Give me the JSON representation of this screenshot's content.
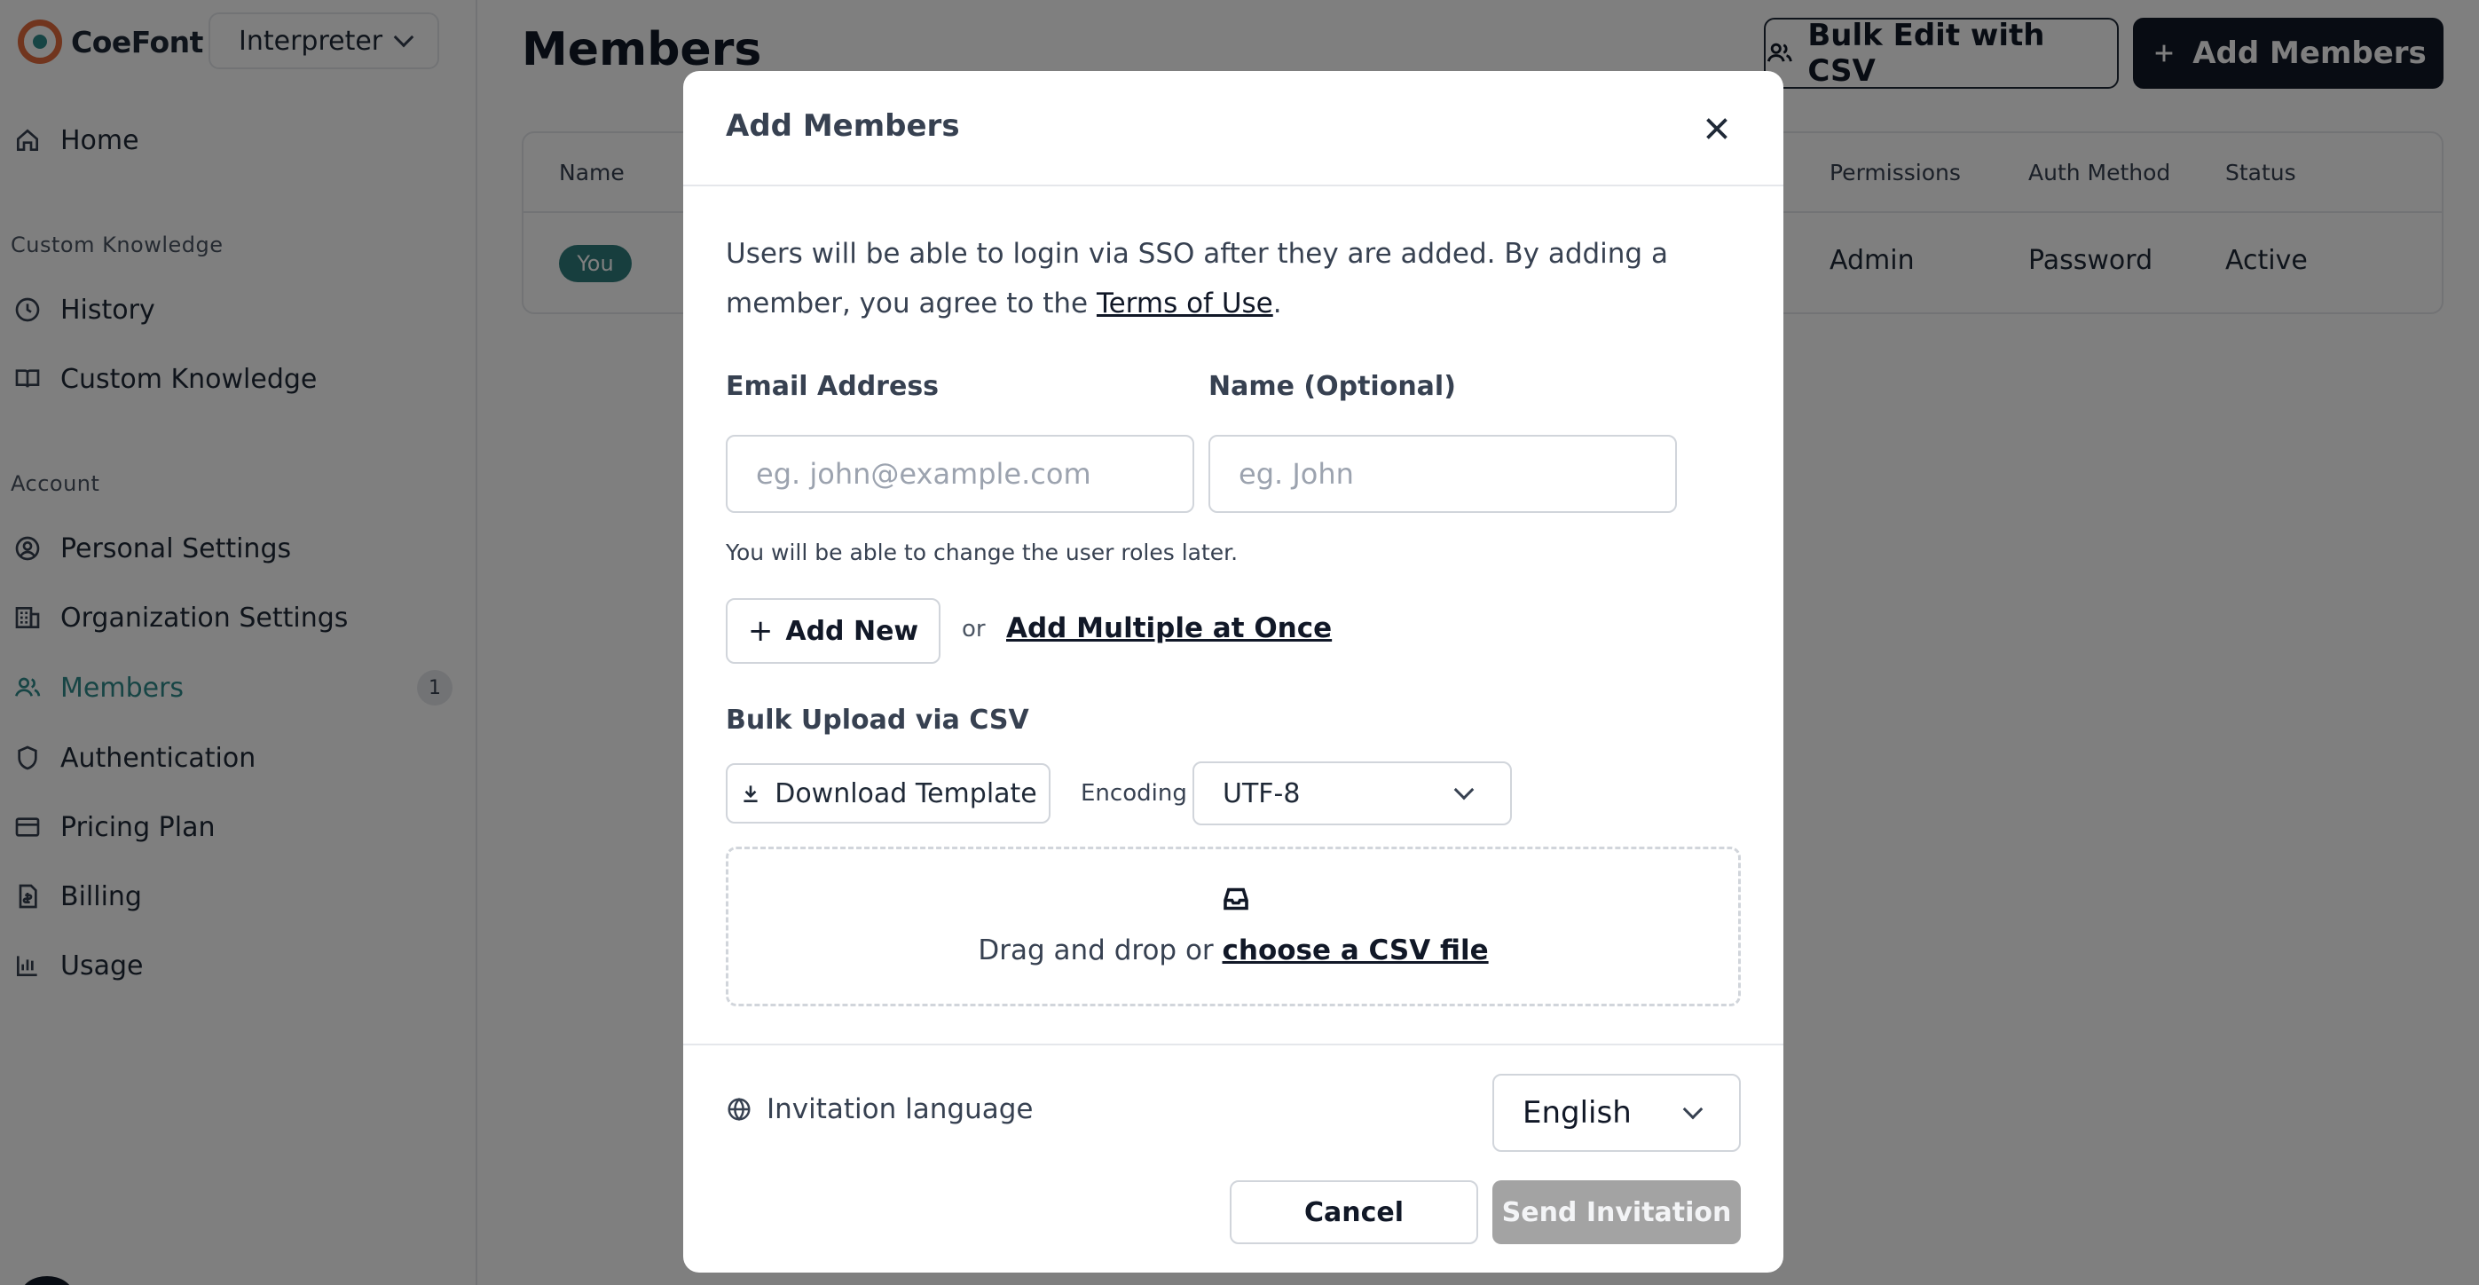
{
  "app": {
    "brand": "CoeFont",
    "workspace": "Interpreter"
  },
  "sidebar": {
    "items": [
      {
        "label": "Home",
        "icon": "home-icon"
      },
      {
        "section": "Custom Knowledge"
      },
      {
        "label": "History",
        "icon": "clock-icon"
      },
      {
        "label": "Custom Knowledge",
        "icon": "book-icon"
      },
      {
        "section": "Account"
      },
      {
        "label": "Personal Settings",
        "icon": "user-circle-icon"
      },
      {
        "label": "Organization Settings",
        "icon": "building-icon"
      },
      {
        "label": "Members",
        "icon": "users-icon",
        "active": true,
        "count": "1"
      },
      {
        "label": "Authentication",
        "icon": "shield-icon"
      },
      {
        "label": "Pricing Plan",
        "icon": "credit-card-icon"
      },
      {
        "label": "Billing",
        "icon": "receipt-icon"
      },
      {
        "label": "Usage",
        "icon": "bar-chart-icon"
      }
    ]
  },
  "main": {
    "title": "Members",
    "bulk_edit_label": "Bulk Edit with CSV",
    "add_members_label": "Add Members",
    "table": {
      "headers": {
        "name": "Name",
        "permissions": "Permissions",
        "auth_method": "Auth Method",
        "status": "Status"
      },
      "rows": [
        {
          "you_badge": "You",
          "permissions": "Admin",
          "auth_method": "Password",
          "status": "Active"
        }
      ]
    }
  },
  "modal": {
    "title": "Add Members",
    "intro_before": "Users will be able to login via SSO after they are added. By adding a member, you agree to the ",
    "terms_link": "Terms of Use",
    "intro_after": ".",
    "email_label": "Email Address",
    "email_placeholder": "eg. john@example.com",
    "email_value": "",
    "name_label": "Name (Optional)",
    "name_placeholder": "eg. John",
    "name_value": "",
    "hint": "You will be able to change the user roles later.",
    "add_new_label": "Add New",
    "or_text": "or",
    "add_multiple_label": "Add Multiple at Once",
    "bulk_label": "Bulk Upload via CSV",
    "download_label": "Download Template",
    "encoding_label": "Encoding",
    "encoding_value": "UTF-8",
    "dropzone_text": "Drag and drop or ",
    "dropzone_link": "choose a CSV file",
    "invitation_language_label": "Invitation language",
    "language_value": "English",
    "cancel_label": "Cancel",
    "send_label": "Send Invitation"
  },
  "colors": {
    "accent": "#2f8a8a",
    "brand_orange": "#e26b3c",
    "dark": "#111827",
    "disabled": "#a3a3a3",
    "overlay": "rgba(0,0,0,0.5)"
  }
}
